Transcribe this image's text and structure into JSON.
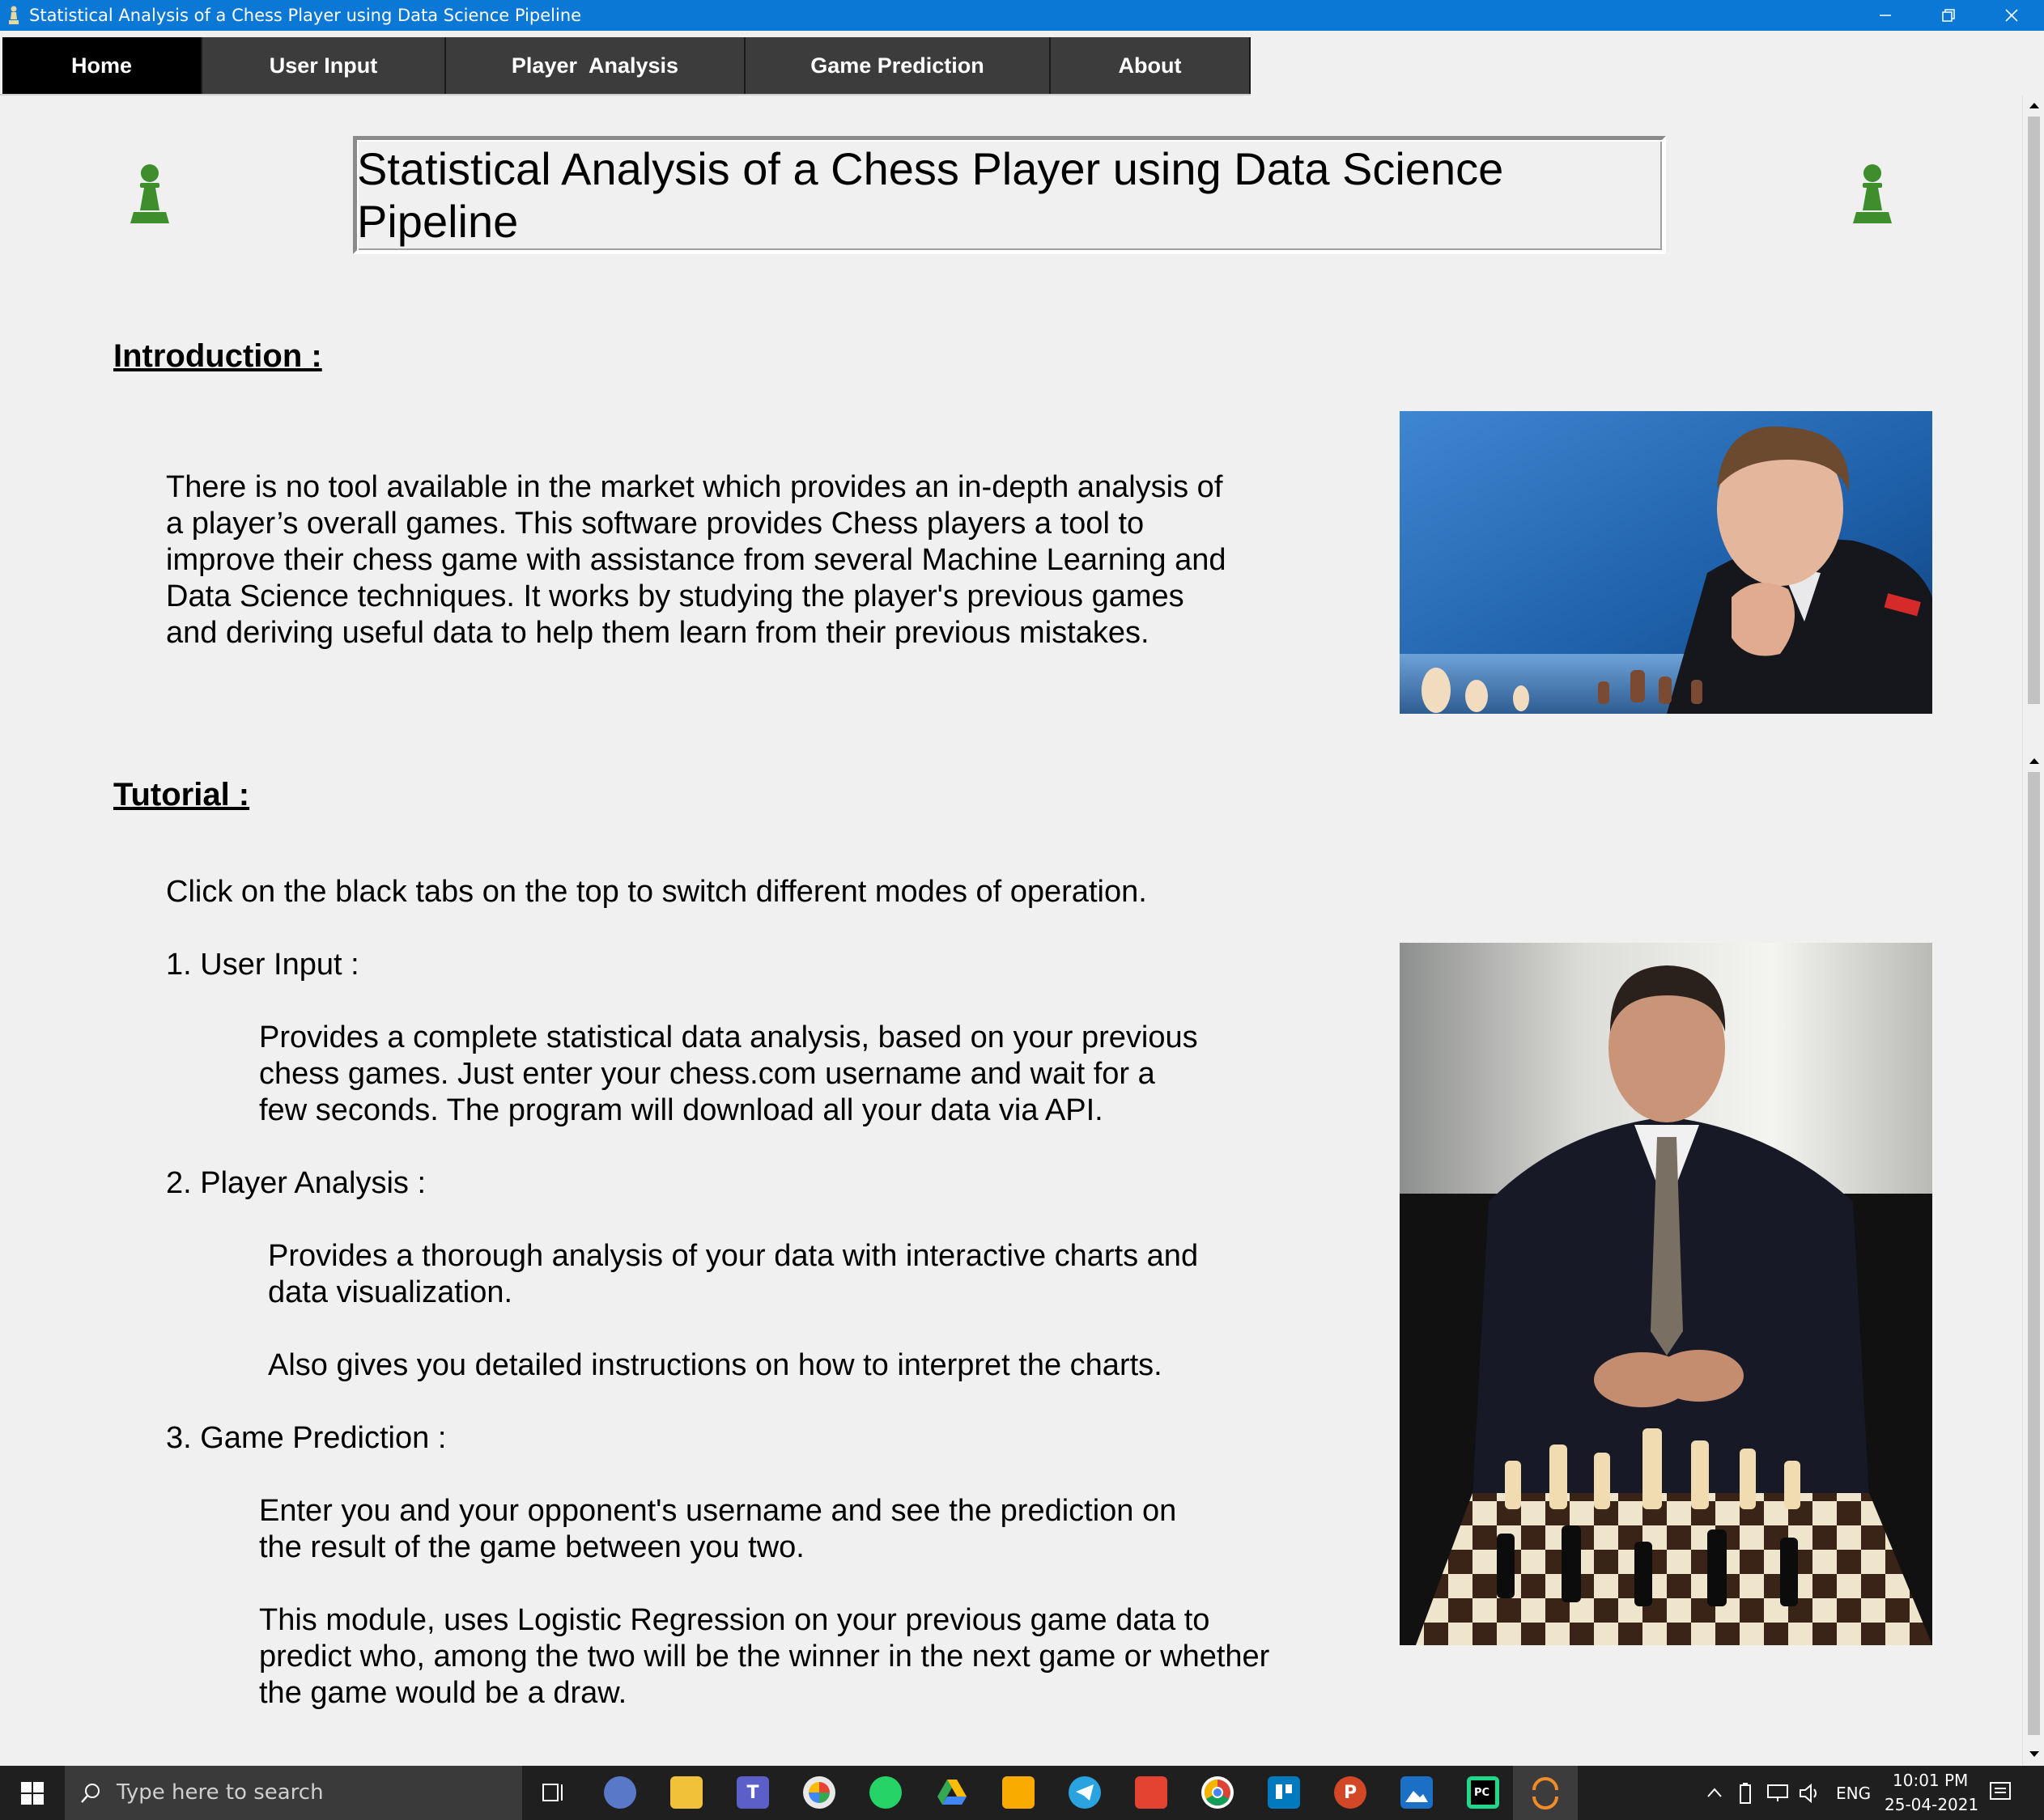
{
  "window": {
    "title": "Statistical Analysis of a Chess Player using Data Science Pipeline"
  },
  "tabs": [
    {
      "label": "Home",
      "active": true
    },
    {
      "label": "User Input",
      "active": false
    },
    {
      "label": "Player  Analysis",
      "active": false
    },
    {
      "label": "Game Prediction",
      "active": false
    },
    {
      "label": "About",
      "active": false
    }
  ],
  "main": {
    "title": "Statistical Analysis of a Chess Player using Data Science Pipeline",
    "intro_heading": "Introduction :",
    "intro_lines": [
      "There is no tool available in the market which provides an in-depth analysis of",
      "a player’s overall games. This software provides Chess players a tool to",
      "improve their chess game with assistance from several Machine Learning and",
      "Data Science techniques. It works by studying the player's previous games",
      "and deriving useful data to help them learn from their previous mistakes."
    ],
    "tutorial_heading": "Tutorial :",
    "tutorial_intro": "Click on the black tabs on the top to switch different modes of operation.",
    "item1_title": "1. User Input :",
    "item1_lines": [
      "Provides a complete statistical data analysis, based on your previous",
      "chess games. Just enter your chess.com username and wait for a",
      "few seconds. The program will download all your data via API."
    ],
    "item2_title": "2. Player Analysis :",
    "item2_lines_a": [
      "Provides a thorough analysis of your data with interactive charts and",
      "data visualization."
    ],
    "item2_line_b": "Also gives you detailed instructions on how to interpret the charts.",
    "item3_title": "3. Game Prediction :",
    "item3_lines_a": [
      "Enter you and your opponent's username and see the prediction on",
      "the result of the game between you two."
    ],
    "item3_lines_b": [
      "This module, uses Logistic Regression on your previous game data to",
      "predict who, among the two will be the winner in the next game or whether",
      "the game would be a draw."
    ]
  },
  "taskbar": {
    "search_placeholder": "Type here to search",
    "language": "ENG",
    "time": "10:01 PM",
    "date": "25-04-2021"
  },
  "colors": {
    "titlebar": "#0a78d4",
    "tab": "#3c3c3c",
    "tab_active": "#000000",
    "pawn": "#3e8e2e",
    "background": "#f0f0f0"
  }
}
